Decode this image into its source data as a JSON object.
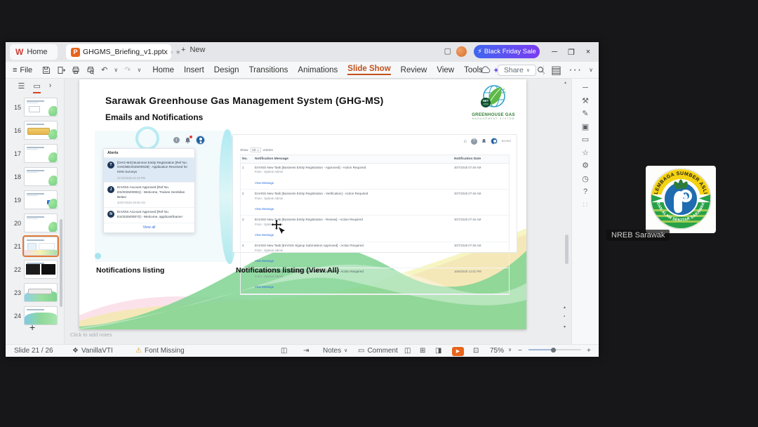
{
  "colors": {
    "accent_orange": "#c2521f",
    "promo_gradient_start": "#3f66f0",
    "promo_gradient_end": "#7b3bf2",
    "link_blue": "#2f6fdc",
    "selection_orange": "#e07b39",
    "logo_green": "#2e7d32",
    "play_orange": "#e8641a"
  },
  "icons": {
    "hamburger": "≡",
    "undo": "↶",
    "redo": "↷",
    "caret-down": "∨",
    "plus": "+",
    "doc-mini": "▫",
    "unsaved": "∗",
    "workspace": "▢",
    "lightning": "⚡",
    "minimize": "─",
    "restore": "❐",
    "close": "×",
    "ai-star": "✦",
    "ellipsis": "···",
    "panel": "▤",
    "list-view": "☰",
    "slide-view": "▭",
    "chevron-right": "›",
    "up-arrow": "▴",
    "down-arrow": "▾",
    "square-dot": "▪",
    "home": "⌂",
    "info": "i",
    "question": "?",
    "warning": "⚠",
    "theme": "❖",
    "pane1": "◫",
    "pane2": "⇥",
    "view-normal": "◫",
    "view-sorter": "⊞",
    "view-read": "◨",
    "play": "▶",
    "fit": "⊡",
    "minus": "−"
  },
  "window": {
    "home_tab": "Home",
    "doc_tab": "GHGMS_Briefing_v1.pptx",
    "new_label": "New",
    "promo": "Black Friday Sale",
    "file_menu": "File",
    "menus": [
      "Home",
      "Insert",
      "Design",
      "Transitions",
      "Animations",
      "Slide Show",
      "Review",
      "View",
      "Tools",
      "WPS AI"
    ],
    "active_menu": "Slide Show",
    "share": "Share",
    "side_tools": [
      {
        "name": "collapse-icon",
        "glyph": "─",
        "dim": false
      },
      {
        "name": "tools-icon",
        "glyph": "⚒",
        "dim": false
      },
      {
        "name": "edit-icon",
        "glyph": "✎",
        "dim": false
      },
      {
        "name": "objects-icon",
        "glyph": "▣",
        "dim": false
      },
      {
        "name": "comment-icon",
        "glyph": "▭",
        "dim": false
      },
      {
        "name": "favorite-icon",
        "glyph": "☆",
        "dim": false
      },
      {
        "name": "settings-icon",
        "glyph": "⚙",
        "dim": false
      },
      {
        "name": "history-icon",
        "glyph": "◷",
        "dim": false
      },
      {
        "name": "help-icon",
        "glyph": "?",
        "dim": false
      },
      {
        "name": "grid-icon",
        "glyph": "∷",
        "dim": true
      }
    ]
  },
  "slide_panel": {
    "selected": 21,
    "thumbnails": [
      {
        "num": 15,
        "variant": "v15"
      },
      {
        "num": 16,
        "variant": "v16"
      },
      {
        "num": 17,
        "variant": "v17"
      },
      {
        "num": 18,
        "variant": "v18"
      },
      {
        "num": 19,
        "variant": "v19"
      },
      {
        "num": 20,
        "variant": "v20"
      },
      {
        "num": 21,
        "variant": "v21"
      },
      {
        "num": 22,
        "variant": "v22"
      },
      {
        "num": 23,
        "variant": "v23"
      },
      {
        "num": 24,
        "variant": "v24"
      }
    ]
  },
  "slide": {
    "title": "Sarawak Greenhouse Gas Management System (GHG-MS)",
    "subtitle": "Emails and Notifications",
    "logo": {
      "badge_top": "NET",
      "badge_bottom": "2050",
      "line1": "GREENHOUSE GAS",
      "line2": "MANAGEMENT SYSTEM"
    },
    "caption_left": "Notifications listing",
    "caption_right": "Notifications listing (View All)",
    "alerts": {
      "header": "Alerts",
      "view_all": "View all",
      "items": [
        {
          "initial": "T",
          "highlight": true,
          "text": "[GHG-MS] Business Entity Registration [Ref No. GHG/BE/2025/00028] - Application Received for KNN Surveys",
          "time": "21/10/2025 02:19 PM"
        },
        {
          "initial": "J",
          "highlight": false,
          "text": "EnVISS Account Approved [Ref No. ES/2025/00081] - Welcome, Trainee Sembilan Belas!",
          "time": "30/07/2025 09:09 AM"
        },
        {
          "initial": "N",
          "highlight": false,
          "text": "EnVISS Account Approved [Ref No. ES/2025/00072] - Welcome, applicantfname!",
          "time": ""
        }
      ]
    },
    "portal": {
      "user": "EnVISS",
      "show_label": "Show",
      "page_size": "10",
      "entries_label": "entries",
      "headers": [
        "No.",
        "Notification Message",
        "Notification Date"
      ],
      "rows": [
        {
          "no": "1",
          "message": "EnVISS New Task [Business Entity Registration - Approved] - Action Required",
          "from": "From : System Admin",
          "link": "View Message",
          "date": "30/7/2025 07:49 AM"
        },
        {
          "no": "2",
          "message": "EnVISS New Task [Business Entity Registration - Verification] - Action Required",
          "from": "From : System Admin",
          "link": "View Message",
          "date": "30/7/2025 07:48 AM"
        },
        {
          "no": "3",
          "message": "EnVISS New Task [Business Entity Registration - Review] - Action Required",
          "from": "From : System Admin",
          "link": "View Message",
          "date": "30/7/2025 07:46 AM"
        },
        {
          "no": "4",
          "message": "EnVISS New Task [EnVISS Signup Submission Approved] - Action Required",
          "from": "From : System Admin",
          "link": "View Message",
          "date": "30/7/2025 07:39 AM"
        },
        {
          "no": "5",
          "message": "EnVISS New Task [EnVISS Signup Submission Approved] - Action Required",
          "from": "From : System Admin",
          "link": "View Message",
          "date": "16/6/2025 12:01 PM"
        }
      ]
    }
  },
  "notes_hint": "Click to add notes",
  "status_bar": {
    "slide_info": "Slide 21 / 26",
    "theme": "VanillaVTI",
    "font_missing": "Font Missing",
    "notes": "Notes",
    "comment": "Comment",
    "zoom": "75%"
  },
  "meeting": {
    "participant_name": "NREB Sarawak",
    "logo_arc_top": "LEMBAGA SUMBER ASLI",
    "logo_arc_bottom": "DAN ALAM SEKITAR SARAWAK"
  }
}
